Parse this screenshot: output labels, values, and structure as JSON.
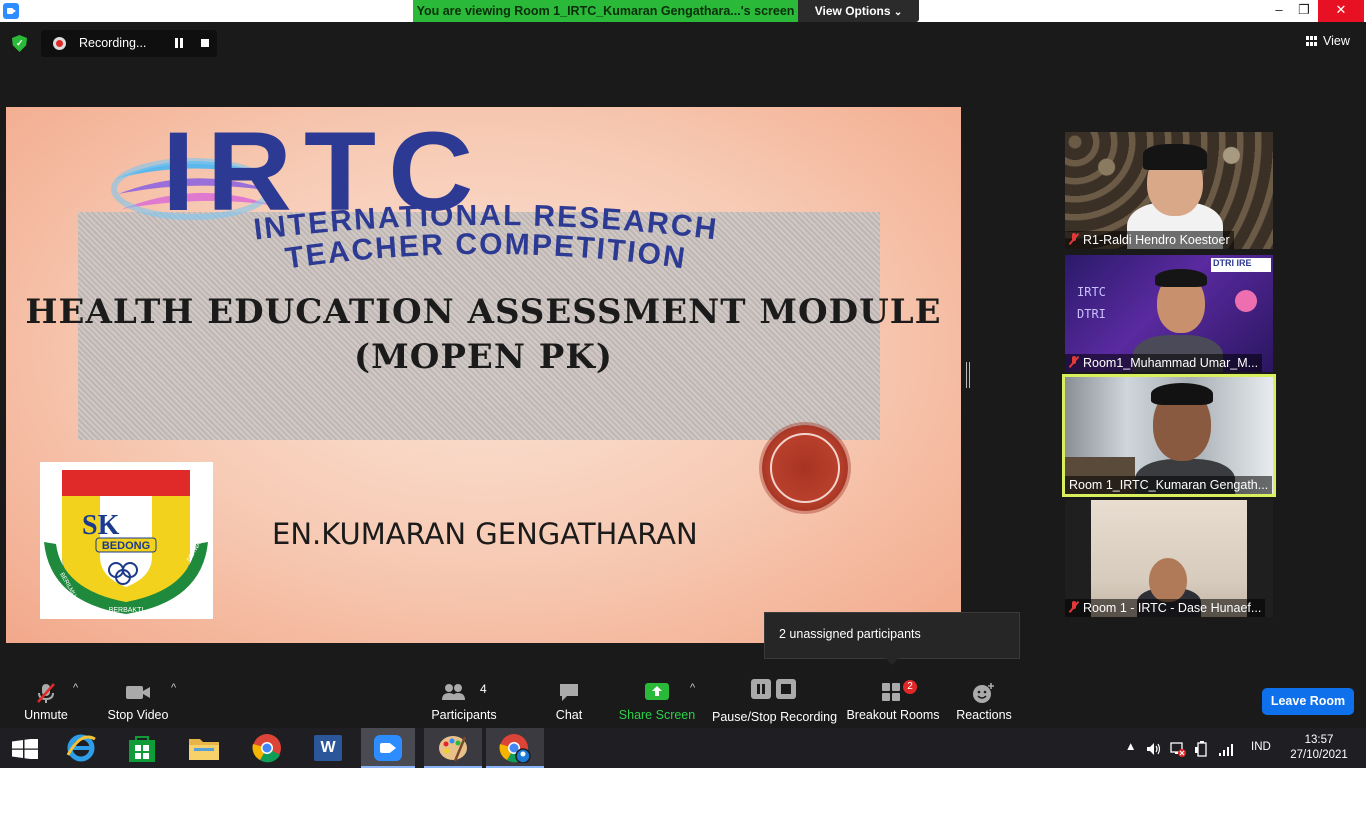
{
  "window": {
    "viewing_banner": "You are viewing Room 1_IRTC_Kumaran Gengathara...'s screen",
    "view_options": "View Options",
    "view_options_caret": "⌄",
    "minimize": "–",
    "maximize": "❐",
    "close": "✕"
  },
  "top_controls": {
    "recording_label": "Recording...",
    "view_label": "View"
  },
  "slide": {
    "logo_text": "IRTC",
    "logo_tagline_line1": "INTERNATIONAL RESEARCH",
    "logo_tagline_line2": "TEACHER COMPETITION",
    "title_line1": "HEALTH EDUCATION ASSESSMENT MODULE",
    "title_line2": "(MOPEN PK)",
    "presenter": "EN.KUMARAN GENGATHARAN",
    "badge_text_top": "SK",
    "badge_text_middle": "BEDONG",
    "badge_ribbon_left": "BERILMU",
    "badge_ribbon_center": "BERBAKTI",
    "badge_ribbon_right": "BERWAWASAN"
  },
  "participants": [
    {
      "name": "R1-Raldi Hendro Koestoer",
      "muted": true,
      "active": false
    },
    {
      "name": "Room1_Muhammad Umar_M...",
      "muted": true,
      "active": false
    },
    {
      "name": "Room 1_IRTC_Kumaran Gengath...",
      "muted": false,
      "active": true
    },
    {
      "name": "Room 1 - IRTC - Dase Hunaef...",
      "muted": true,
      "active": false
    }
  ],
  "tile2_overlay": {
    "top_logo": "DTRI",
    "top_logo2": "IRE",
    "side_text1": "IRTC",
    "side_text2": "DTRI"
  },
  "tooltip": {
    "text": "2 unassigned participants"
  },
  "toolbar": {
    "unmute": "Unmute",
    "stop_video": "Stop Video",
    "participants": "Participants",
    "participants_count": "4",
    "chat": "Chat",
    "share_screen": "Share Screen",
    "pause_stop_recording": "Pause/Stop Recording",
    "breakout_rooms": "Breakout Rooms",
    "breakout_badge": "2",
    "reactions": "Reactions",
    "leave_room": "Leave Room",
    "caret": "^"
  },
  "taskbar": {
    "apps": [
      "windows-start",
      "internet-explorer",
      "microsoft-store",
      "file-explorer",
      "chrome",
      "word",
      "zoom",
      "paint",
      "chrome-profile"
    ],
    "word_letter": "W",
    "language": "IND",
    "time": "13:57",
    "date": "27/10/2021"
  },
  "colors": {
    "banner_green": "#2bb93a",
    "leave_blue": "#0e71eb",
    "active_tile_outline": "#d9ef5e",
    "irtc_blue": "#2c3a94"
  }
}
